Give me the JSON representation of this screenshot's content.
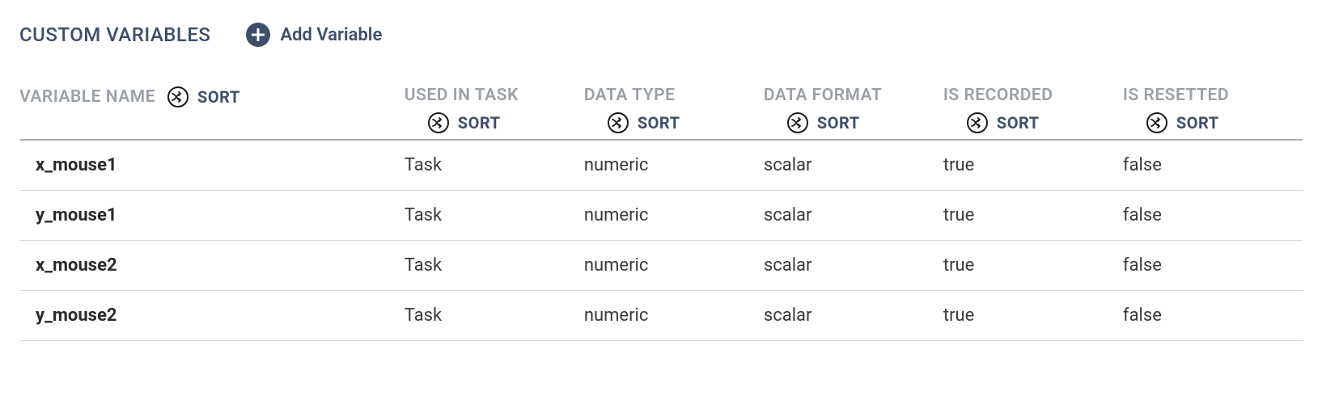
{
  "header": {
    "title": "CUSTOM VARIABLES",
    "add_label": "Add Variable"
  },
  "columns": {
    "name": "VARIABLE NAME",
    "used_in_task": "USED IN TASK",
    "data_type": "DATA TYPE",
    "data_format": "DATA FORMAT",
    "is_recorded": "IS RECORDED",
    "is_resetted": "IS RESETTED",
    "sort_label": "SORT"
  },
  "rows": [
    {
      "name": "x_mouse1",
      "task": "Task",
      "dtype": "numeric",
      "dformat": "scalar",
      "recorded": "true",
      "resetted": "false"
    },
    {
      "name": "y_mouse1",
      "task": "Task",
      "dtype": "numeric",
      "dformat": "scalar",
      "recorded": "true",
      "resetted": "false"
    },
    {
      "name": "x_mouse2",
      "task": "Task",
      "dtype": "numeric",
      "dformat": "scalar",
      "recorded": "true",
      "resetted": "false"
    },
    {
      "name": "y_mouse2",
      "task": "Task",
      "dtype": "numeric",
      "dformat": "scalar",
      "recorded": "true",
      "resetted": "false"
    }
  ]
}
